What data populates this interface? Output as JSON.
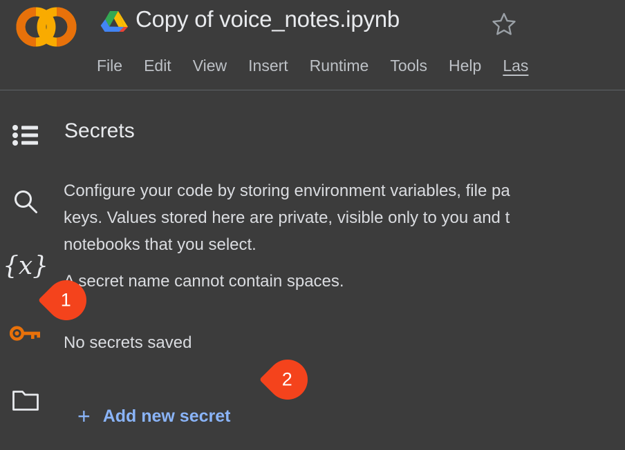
{
  "header": {
    "logo_name": "colab-logo",
    "drive_icon": "google-drive-icon",
    "notebook_title": "Copy of voice_notes.ipynb",
    "star_icon": "star-outline-icon",
    "menu_items": [
      {
        "label": "File"
      },
      {
        "label": "Edit"
      },
      {
        "label": "View"
      },
      {
        "label": "Insert"
      },
      {
        "label": "Runtime"
      },
      {
        "label": "Tools"
      },
      {
        "label": "Help"
      }
    ],
    "last_saved_label": "Las"
  },
  "sidebar": {
    "items": [
      {
        "name": "table-of-contents",
        "icon": "list-icon"
      },
      {
        "name": "find-and-replace",
        "icon": "search-icon"
      },
      {
        "name": "variables",
        "icon": "variables-braces-icon",
        "glyph": "{x}"
      },
      {
        "name": "secrets",
        "icon": "key-icon",
        "active": true
      },
      {
        "name": "files",
        "icon": "folder-icon"
      }
    ]
  },
  "panel": {
    "title": "Secrets",
    "description_lines": [
      "Configure your code by storing environment variables, file pa",
      "keys. Values stored here are private, visible only to you and t",
      "notebooks that you select."
    ],
    "note": "A secret name cannot contain spaces.",
    "empty_state": "No secrets saved",
    "add_secret_label": "Add new secret",
    "add_secret_plus": "+"
  },
  "annotations": [
    {
      "id": "1",
      "label": "1"
    },
    {
      "id": "2",
      "label": "2"
    }
  ],
  "colors": {
    "background": "#3c3c3c",
    "link": "#8ab4f8",
    "badge": "#f4431c",
    "key_orange": "#e8710a",
    "text": "#dadce0"
  }
}
